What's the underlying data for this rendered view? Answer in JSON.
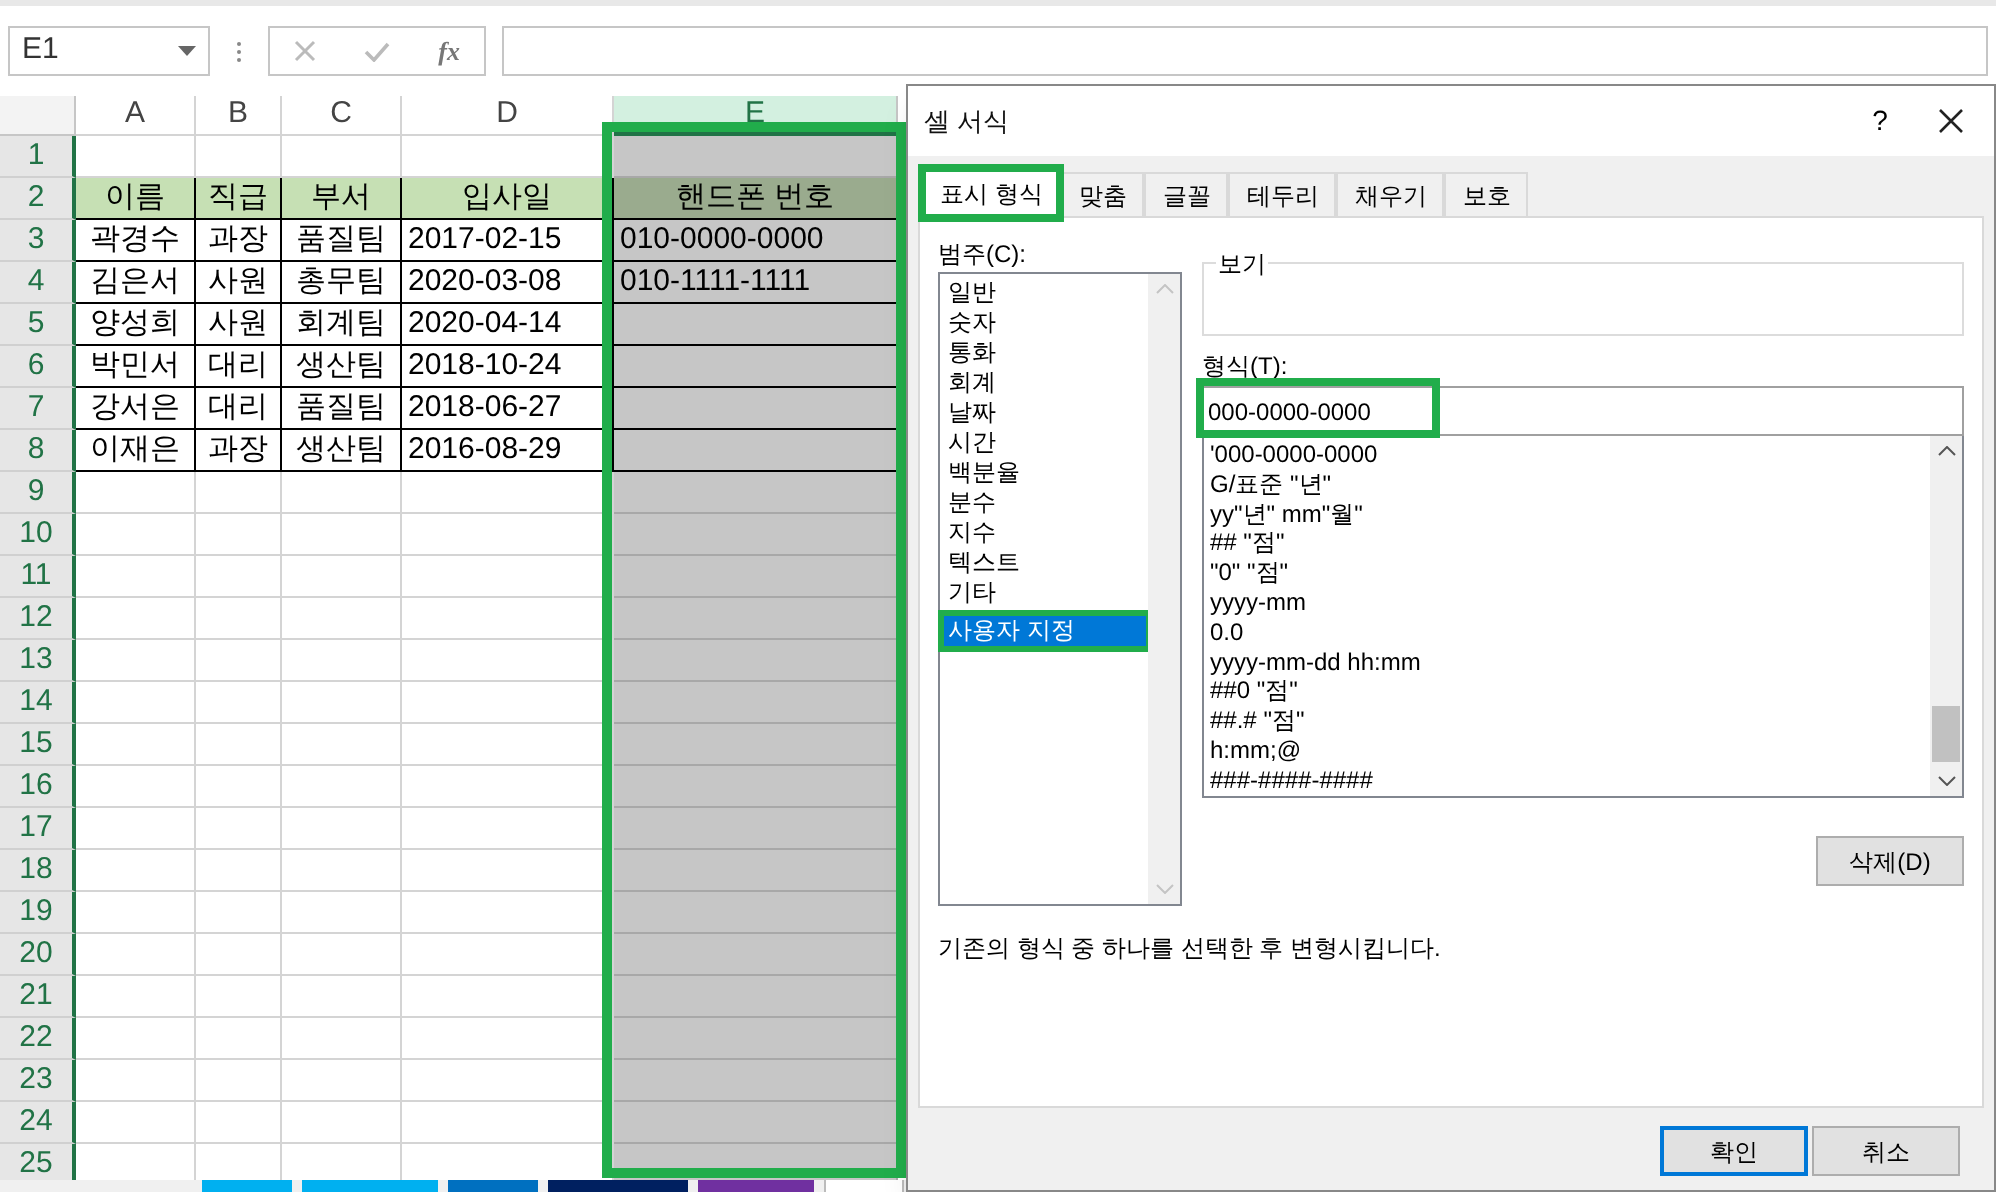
{
  "name_box": "E1",
  "formula_icon": "fx",
  "sheet": {
    "columns": [
      {
        "label": "A",
        "selected": false,
        "highlighted": false
      },
      {
        "label": "B",
        "selected": false,
        "highlighted": false
      },
      {
        "label": "C",
        "selected": false,
        "highlighted": false
      },
      {
        "label": "D",
        "selected": false,
        "highlighted": false
      },
      {
        "label": "E",
        "selected": true,
        "highlighted": true
      }
    ],
    "rows": [
      {
        "number": "1"
      },
      {
        "number": "2",
        "kind": "header",
        "cells": [
          "이름",
          "직급",
          "부서",
          "입사일",
          "핸드폰 번호"
        ]
      },
      {
        "number": "3",
        "kind": "data",
        "cells": [
          "곽경수",
          "과장",
          "품질팀",
          "2017-02-15",
          "010-0000-0000"
        ]
      },
      {
        "number": "4",
        "kind": "data",
        "cells": [
          "김은서",
          "사원",
          "총무팀",
          "2020-03-08",
          "010-1111-1111"
        ]
      },
      {
        "number": "5",
        "kind": "data",
        "cells": [
          "양성희",
          "사원",
          "회계팀",
          "2020-04-14"
        ]
      },
      {
        "number": "6",
        "kind": "data",
        "cells": [
          "박민서",
          "대리",
          "생산팀",
          "2018-10-24"
        ]
      },
      {
        "number": "7",
        "kind": "data",
        "cells": [
          "강서은",
          "대리",
          "품질팀",
          "2018-06-27"
        ]
      },
      {
        "number": "8",
        "kind": "data",
        "cells": [
          "이재은",
          "과장",
          "생산팀",
          "2016-08-29"
        ]
      },
      {
        "number": "9"
      },
      {
        "number": "10"
      },
      {
        "number": "11"
      },
      {
        "number": "12"
      },
      {
        "number": "13"
      },
      {
        "number": "14"
      },
      {
        "number": "15"
      },
      {
        "number": "16"
      },
      {
        "number": "17"
      },
      {
        "number": "18"
      },
      {
        "number": "19"
      },
      {
        "number": "20"
      },
      {
        "number": "21"
      },
      {
        "number": "22"
      },
      {
        "number": "23"
      },
      {
        "number": "24"
      },
      {
        "number": "25"
      }
    ],
    "sheet_tabs": [
      {
        "color": "#00b0f0",
        "selected": false
      },
      {
        "color": "#00b0f0",
        "selected": false
      },
      {
        "color": "#0070c0",
        "selected": false
      },
      {
        "color": "#002060",
        "selected": false
      },
      {
        "color": "#7030a0",
        "selected": false
      },
      {
        "color": "#ffffff",
        "selected": true
      }
    ]
  },
  "dialog": {
    "title": "셀 서식",
    "help": "?",
    "tabs": [
      {
        "label": "표시 형식",
        "selected": true,
        "highlighted": true
      },
      {
        "label": "맞춤",
        "selected": false,
        "highlighted": false
      },
      {
        "label": "글꼴",
        "selected": false,
        "highlighted": false
      },
      {
        "label": "테두리",
        "selected": false,
        "highlighted": false
      },
      {
        "label": "채우기",
        "selected": false,
        "highlighted": false
      },
      {
        "label": "보호",
        "selected": false,
        "highlighted": false
      }
    ],
    "category_label": "범주(C):",
    "categories": [
      {
        "label": "일반",
        "selected": false,
        "highlighted": false
      },
      {
        "label": "숫자",
        "selected": false,
        "highlighted": false
      },
      {
        "label": "통화",
        "selected": false,
        "highlighted": false
      },
      {
        "label": "회계",
        "selected": false,
        "highlighted": false
      },
      {
        "label": "날짜",
        "selected": false,
        "highlighted": false
      },
      {
        "label": "시간",
        "selected": false,
        "highlighted": false
      },
      {
        "label": "백분율",
        "selected": false,
        "highlighted": false
      },
      {
        "label": "분수",
        "selected": false,
        "highlighted": false
      },
      {
        "label": "지수",
        "selected": false,
        "highlighted": false
      },
      {
        "label": "텍스트",
        "selected": false,
        "highlighted": false
      },
      {
        "label": "기타",
        "selected": false,
        "highlighted": false
      },
      {
        "label": "사용자 지정",
        "selected": true,
        "highlighted": true
      }
    ],
    "sample_label": "보기",
    "format_label": "형식(T):",
    "format_input": {
      "value": "000-0000-0000",
      "highlighted": true
    },
    "formats": [
      "'000-0000-0000",
      "G/표준 \"년\"",
      "yy\"년\" mm\"월\"",
      "## \"점\"",
      "\"0\" \"점\"",
      "yyyy-mm",
      "0.0",
      "yyyy-mm-dd hh:mm",
      "##0 \"점\"",
      "##.# \"점\"",
      "h:mm;@",
      "###-####-####"
    ],
    "delete_button": "삭제(D)",
    "description": "기존의 형식 중 하나를 선택한 후 변형시킵니다.",
    "ok_button": "확인",
    "cancel_button": "취소"
  }
}
